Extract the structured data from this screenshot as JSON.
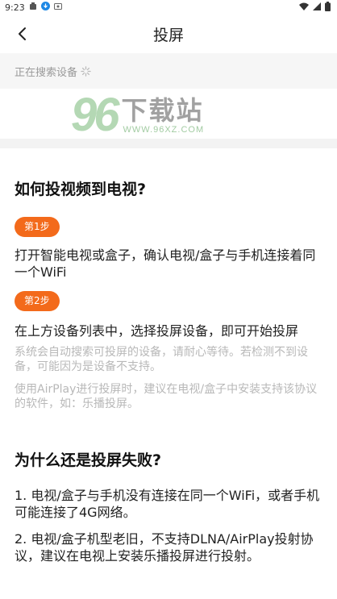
{
  "status_bar": {
    "time": "9:23",
    "icons_left": [
      "notification-icon",
      "download-icon",
      "cast-status-icon"
    ],
    "icons_right": [
      "wifi-icon",
      "signal-icon",
      "battery-icon"
    ]
  },
  "nav": {
    "back_icon": "back-arrow-icon",
    "title": "投屏"
  },
  "search": {
    "status_text": "正在搜索设备",
    "spinner_icon": "loading-spinner-icon"
  },
  "watermark": {
    "number": "96",
    "brand": "下载站",
    "url": "WWW.96XZ.COM"
  },
  "guide": {
    "heading": "如何投视频到电视?",
    "steps": [
      {
        "badge": "第1步",
        "text": "打开智能电视或盒子，确认电视/盒子与手机连接着同一个WiFi"
      },
      {
        "badge": "第2步",
        "text": "在上方设备列表中，选择投屏设备，即可开始投屏"
      }
    ],
    "hints": [
      "系统会自动搜索可投屏的设备，请耐心等待。若检测不到设备，可能因为是设备不支持。",
      "使用AirPlay进行投屏时，建议在电视/盒子中安装支持该协议的软件，如：乐播投屏。"
    ]
  },
  "failure": {
    "heading": "为什么还是投屏失败?",
    "reasons": [
      "1. 电视/盒子与手机没有连接在同一个WiFi，或者手机可能连接了4G网络。",
      "2. 电视/盒子机型老旧，不支持DLNA/AirPlay投射协议，建议在电视上安装乐播投屏进行投射。"
    ]
  },
  "colors": {
    "accent": "#f36a1b",
    "hint": "#b8b8b8",
    "strip_bg": "#f6f6f6"
  }
}
